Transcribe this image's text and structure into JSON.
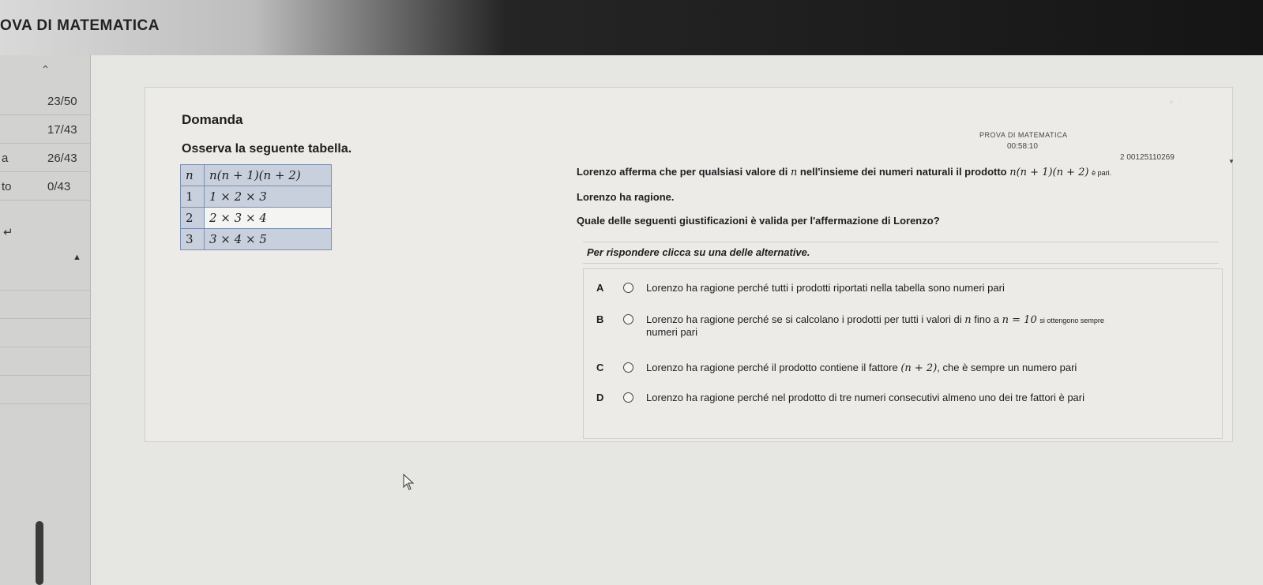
{
  "app": {
    "title": "OVA DI MATEMATICA"
  },
  "sidebar": {
    "collapse_icon": "chevron-up-icon",
    "rows": [
      {
        "tag": "",
        "score": "23/50"
      },
      {
        "tag": "",
        "score": "17/43"
      },
      {
        "tag": "a",
        "score": "26/43"
      },
      {
        "tag": "to",
        "score": "0/43"
      }
    ],
    "back_icon": "return-arrow-icon",
    "expand_icon": "chevron-left-icon",
    "caret_icon": "triangle-up-icon"
  },
  "header": {
    "exam_name": "PROVA DI MATEMATICA",
    "timer": "00:58:10",
    "user_id": "2 00125110269",
    "dropdown_icon": "chevron-down-icon"
  },
  "question": {
    "label": "Domanda",
    "table_intro": "Osserva la seguente tabella.",
    "table": {
      "headers": [
        "n",
        "n(n + 1)(n + 2)"
      ],
      "rows": [
        [
          "1",
          "1 × 2 × 3"
        ],
        [
          "2",
          "2 × 3 × 4"
        ],
        [
          "3",
          "3 × 4 × 5"
        ]
      ]
    },
    "statement_before": "Lorenzo afferma che per qualsiasi valore di ",
    "statement_var": "n",
    "statement_mid": " nell'insieme dei numeri naturali il prodotto ",
    "statement_expr": "n(n + 1)(n + 2)",
    "statement_after": "è pari.",
    "claim": "Lorenzo ha ragione.",
    "prompt": "Quale delle seguenti giustificazioni è valida per l'affermazione di Lorenzo?",
    "instruction": "Per rispondere clicca su una delle alternative."
  },
  "options": [
    {
      "letter": "A",
      "text": "Lorenzo ha ragione perché tutti i prodotti riportati nella tabella sono numeri pari"
    },
    {
      "letter": "B",
      "text_before": "Lorenzo ha ragione perché se si calcolano i prodotti per tutti i valori di ",
      "var": "n",
      "text_mid": " fino a ",
      "expr": "n = 10",
      "text_after": "si ottengono sempre",
      "text_line2": "numeri pari"
    },
    {
      "letter": "C",
      "text_before": "Lorenzo ha ragione perché il prodotto contiene il fattore ",
      "expr": "(n + 2)",
      "text_after": ", che è sempre un numero pari"
    },
    {
      "letter": "D",
      "text": "Lorenzo ha ragione perché nel prodotto di tre numeri consecutivi almeno uno dei tre fattori è pari"
    }
  ],
  "cursor": {
    "icon": "mouse-pointer-icon"
  }
}
